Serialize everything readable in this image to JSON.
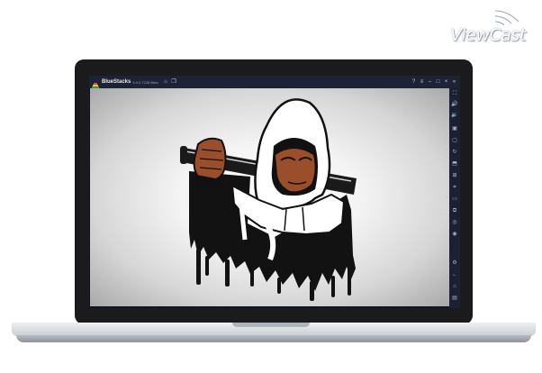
{
  "watermark": {
    "brand": "ViewCast"
  },
  "window": {
    "app_name": "BlueStacks",
    "version": "5.0.0.7228 Beta",
    "left_icons": [
      "home-icon",
      "multi-instance-icon"
    ],
    "right_icons": [
      "help-icon",
      "menu-icon",
      "minimize-icon",
      "maximize-icon",
      "close-icon",
      "collapse-sidebar-icon"
    ]
  },
  "sidebar": {
    "icons": [
      "fullscreen-icon",
      "volume-up-icon",
      "volume-down-icon",
      "play-icon",
      "screenshot-icon",
      "rotate-icon",
      "install-apk-icon",
      "gamepad-icon",
      "capture-icon",
      "folder-icon",
      "multi-instance-icon",
      "eco-mode-icon",
      "macro-icon",
      "settings-icon",
      "back-icon",
      "home-icon",
      "recent-apps-icon"
    ]
  },
  "content": {
    "artwork": "hooded-figure-with-bat"
  },
  "colors": {
    "titlebar": "#1e2235",
    "sidebar": "#1b2033",
    "lid": "#1b1b1d",
    "skin": "#9a4f2a"
  }
}
